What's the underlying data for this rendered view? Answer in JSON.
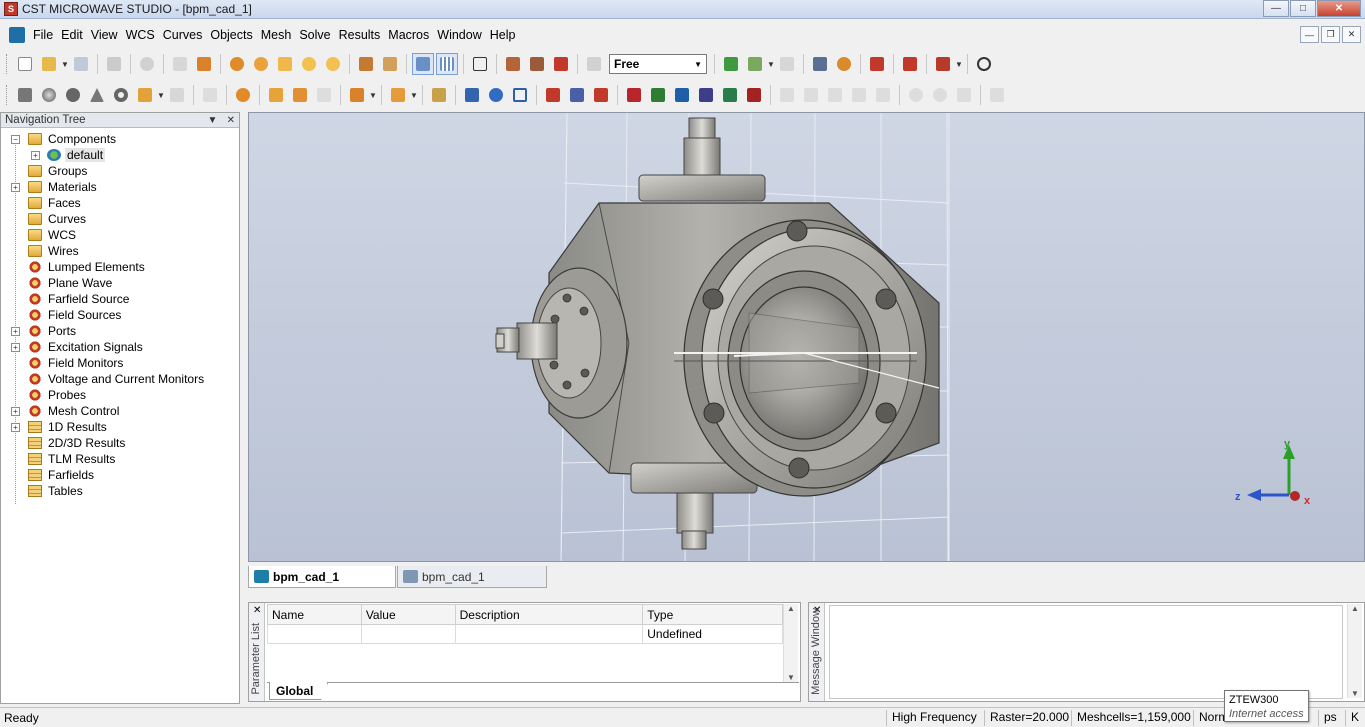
{
  "window": {
    "title": "CST MICROWAVE STUDIO - [bpm_cad_1]",
    "app_icon_letter": "S"
  },
  "menu": {
    "items": [
      "File",
      "Edit",
      "View",
      "WCS",
      "Curves",
      "Objects",
      "Mesh",
      "Solve",
      "Results",
      "Macros",
      "Window",
      "Help"
    ]
  },
  "toolbar": {
    "view_mode": "Free"
  },
  "nav": {
    "title": "Navigation Tree",
    "items": [
      {
        "label": "Components",
        "expander": "−",
        "icon": "folder"
      },
      {
        "label": "default",
        "expander": "+",
        "icon": "component"
      },
      {
        "label": "Groups",
        "expander": "",
        "icon": "folder"
      },
      {
        "label": "Materials",
        "expander": "+",
        "icon": "folder"
      },
      {
        "label": "Faces",
        "expander": "",
        "icon": "folder"
      },
      {
        "label": "Curves",
        "expander": "",
        "icon": "folder"
      },
      {
        "label": "WCS",
        "expander": "",
        "icon": "folder"
      },
      {
        "label": "Wires",
        "expander": "",
        "icon": "folder"
      },
      {
        "label": "Lumped Elements",
        "expander": "",
        "icon": "gear"
      },
      {
        "label": "Plane Wave",
        "expander": "",
        "icon": "gear"
      },
      {
        "label": "Farfield Source",
        "expander": "",
        "icon": "gear"
      },
      {
        "label": "Field Sources",
        "expander": "",
        "icon": "gear"
      },
      {
        "label": "Ports",
        "expander": "+",
        "icon": "gear"
      },
      {
        "label": "Excitation Signals",
        "expander": "+",
        "icon": "gear"
      },
      {
        "label": "Field Monitors",
        "expander": "",
        "icon": "gear"
      },
      {
        "label": "Voltage and Current Monitors",
        "expander": "",
        "icon": "gear"
      },
      {
        "label": "Probes",
        "expander": "",
        "icon": "gear"
      },
      {
        "label": "Mesh Control",
        "expander": "+",
        "icon": "gear"
      },
      {
        "label": "1D Results",
        "expander": "+",
        "icon": "result"
      },
      {
        "label": "2D/3D Results",
        "expander": "",
        "icon": "result"
      },
      {
        "label": "TLM Results",
        "expander": "",
        "icon": "result"
      },
      {
        "label": "Farfields",
        "expander": "",
        "icon": "result"
      },
      {
        "label": "Tables",
        "expander": "",
        "icon": "result"
      }
    ]
  },
  "viewport": {
    "axes": {
      "x": "x",
      "y": "y",
      "z": "z"
    }
  },
  "doc_tabs": [
    {
      "label": "bpm_cad_1",
      "active": true
    },
    {
      "label": "bpm_cad_1",
      "active": false
    }
  ],
  "params": {
    "side_label": "Parameter List",
    "columns": [
      "Name",
      "Value",
      "Description",
      "Type"
    ],
    "rows": [
      [
        "",
        "",
        "",
        "Undefined"
      ]
    ],
    "tab": "Global"
  },
  "messages": {
    "side_label": "Message Window"
  },
  "status": {
    "ready": "Ready",
    "solver": "High Frequency",
    "raster": "Raster=20.000",
    "meshcells": "Meshcells=1,159,000",
    "norm": "Norm",
    "unit_time": "ps",
    "unit_temp": "K"
  },
  "tooltip": {
    "title": "ZTEW300",
    "subtitle": "Internet access"
  },
  "colors": {
    "viewport_top": "#cfd6e4",
    "viewport_bottom": "#b9c2d4",
    "axis_y": "#2aa02a",
    "axis_z": "#2b55c9",
    "axis_x": "#d22b2b"
  }
}
